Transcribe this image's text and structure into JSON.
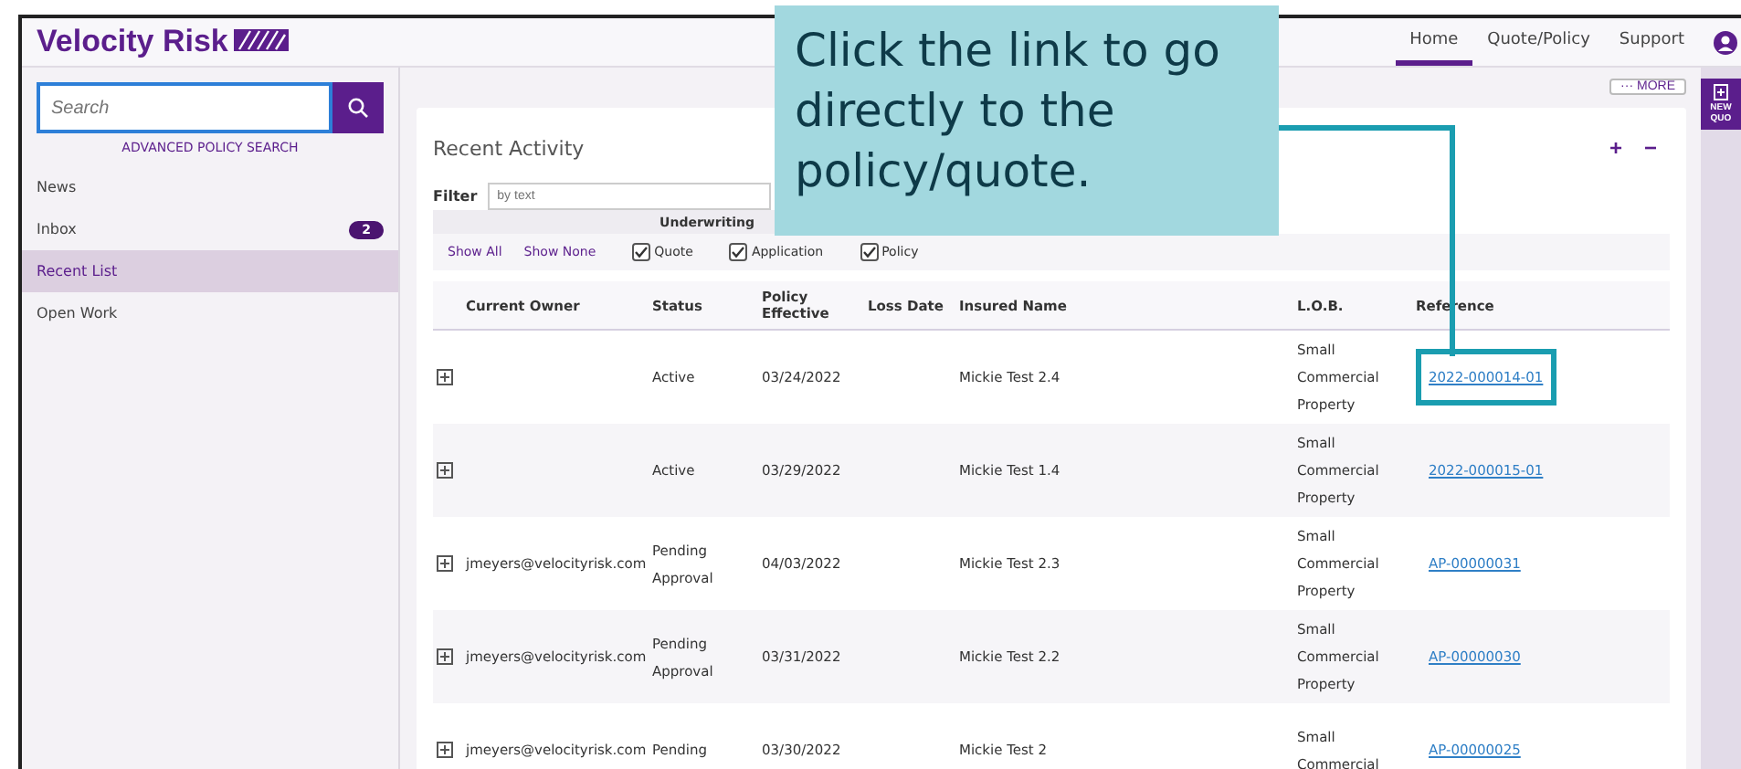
{
  "brand": {
    "name": "Velocity Risk"
  },
  "nav": [
    {
      "label": "Home",
      "selected": true
    },
    {
      "label": "Quote/Policy",
      "selected": false
    },
    {
      "label": "Support",
      "selected": false
    }
  ],
  "sidebar": {
    "search": {
      "placeholder": "Search"
    },
    "advanced_link": "ADVANCED POLICY SEARCH",
    "items": [
      {
        "label": "News",
        "selected": false
      },
      {
        "label": "Inbox",
        "badge": "2",
        "selected": false
      },
      {
        "label": "Recent List",
        "selected": true
      },
      {
        "label": "Open Work",
        "selected": false
      }
    ]
  },
  "more_button": "··· MORE",
  "new_quote_button": "NEW QUO",
  "panel": {
    "title": "Recent Activity",
    "expand_all": "+",
    "collapse_all": "−",
    "filter": {
      "label": "Filter",
      "placeholder": "by text"
    },
    "group_heading": "Underwriting",
    "show_all": "Show All",
    "show_none": "Show None",
    "checks": [
      {
        "label": "Quote",
        "checked": true
      },
      {
        "label": "Application",
        "checked": true
      },
      {
        "label": "Policy",
        "checked": true
      }
    ],
    "columns": [
      "Current Owner",
      "Status",
      "Policy Effective",
      "Loss Date",
      "Insured Name",
      "L.O.B.",
      "Reference"
    ],
    "rows": [
      {
        "owner": "",
        "status": "Active",
        "effective": "03/24/2022",
        "loss_date": "",
        "insured": "Mickie Test 2.4",
        "lob": "Small Commercial Property",
        "reference": "2022-000014-01",
        "highlighted": true
      },
      {
        "owner": "",
        "status": "Active",
        "effective": "03/29/2022",
        "loss_date": "",
        "insured": "Mickie Test 1.4",
        "lob": "Small Commercial Property",
        "reference": "2022-000015-01",
        "highlighted": false
      },
      {
        "owner": "jmeyers@velocityrisk.com",
        "status": "Pending Approval",
        "effective": "04/03/2022",
        "loss_date": "",
        "insured": "Mickie Test 2.3",
        "lob": "Small Commercial Property",
        "reference": "AP-00000031",
        "highlighted": false
      },
      {
        "owner": "jmeyers@velocityrisk.com",
        "status": "Pending Approval",
        "effective": "03/31/2022",
        "loss_date": "",
        "insured": "Mickie Test 2.2",
        "lob": "Small Commercial Property",
        "reference": "AP-00000030",
        "highlighted": false
      },
      {
        "owner": "jmeyers@velocityrisk.com",
        "status": "Pending",
        "effective": "03/30/2022",
        "loss_date": "",
        "insured": "Mickie Test 2",
        "lob": "Small Commercial",
        "reference": "AP-00000025",
        "highlighted": false
      }
    ]
  },
  "callout": {
    "text": "Click the link to go directly to the policy/quote."
  }
}
